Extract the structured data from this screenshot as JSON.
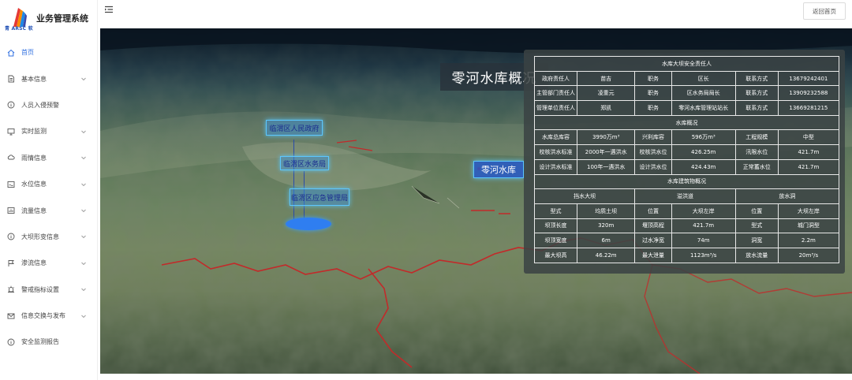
{
  "app": {
    "logo_text": "青 ARSC 软",
    "title": "业务管理系统"
  },
  "header": {
    "back_label": "返回首页"
  },
  "sidebar": {
    "items": [
      {
        "label": "首页",
        "icon": "home-icon",
        "active": true
      },
      {
        "label": "基本信息",
        "icon": "document-icon"
      },
      {
        "label": "人员入侵预警",
        "icon": "info-circle-icon"
      },
      {
        "label": "实时监测",
        "icon": "monitor-icon"
      },
      {
        "label": "雨情信息",
        "icon": "cloud-icon"
      },
      {
        "label": "水位信息",
        "icon": "water-level-icon"
      },
      {
        "label": "流量信息",
        "icon": "chart-icon"
      },
      {
        "label": "大坝形变信息",
        "icon": "info-circle-icon"
      },
      {
        "label": "渗流信息",
        "icon": "flag-icon"
      },
      {
        "label": "警戒指标设置",
        "icon": "alarm-icon"
      },
      {
        "label": "信息交换与发布",
        "icon": "mail-icon"
      },
      {
        "label": "安全监测报告",
        "icon": "info-circle-icon"
      }
    ]
  },
  "map": {
    "title": "零河水库概况",
    "labels": {
      "gov": "临渭区人民政府",
      "water_bureau": "临渭区水务局",
      "flood_office": "临渭区应急管理局",
      "reservoir": "零河水库"
    }
  },
  "info": {
    "safety_title": "水库大坝安全责任人",
    "safety_rows": [
      [
        "政府责任人",
        "苗吉",
        "职务",
        "区长",
        "联系方式",
        "13679242401"
      ],
      [
        "主管部门责任人",
        "凌重元",
        "职务",
        "区水务局局长",
        "联系方式",
        "13909232588"
      ],
      [
        "管理单位责任人",
        "郑凯",
        "职务",
        "零河水库管理站站长",
        "联系方式",
        "13669281215"
      ]
    ],
    "overview_title": "水库概况",
    "overview_rows": [
      [
        "水库总库容",
        "3990万m³",
        "兴利库容",
        "596万m³",
        "工程规模",
        "中型"
      ],
      [
        "校核洪水标准",
        "2000年一遇洪水",
        "校核洪水位",
        "426.25m",
        "汛限水位",
        "421.7m"
      ],
      [
        "设计洪水标准",
        "100年一遇洪水",
        "设计洪水位",
        "424.43m",
        "正常蓄水位",
        "421.7m"
      ]
    ],
    "building_title": "水库建筑物概况",
    "building_groups": [
      "挡水大坝",
      "溢洪道",
      "放水洞"
    ],
    "building_rows": [
      [
        "型式",
        "均质土坝",
        "位置",
        "大坝左岸",
        "位置",
        "大坝左岸"
      ],
      [
        "坝顶长度",
        "320m",
        "堰顶高程",
        "421.7m",
        "型式",
        "城门洞型"
      ],
      [
        "坝顶宽度",
        "6m",
        "过水净宽",
        "74m",
        "洞宽",
        "2.2m"
      ],
      [
        "最大坝高",
        "46.22m",
        "最大泄量",
        "1123m³/s",
        "放水流量",
        "20m³/s"
      ]
    ]
  }
}
